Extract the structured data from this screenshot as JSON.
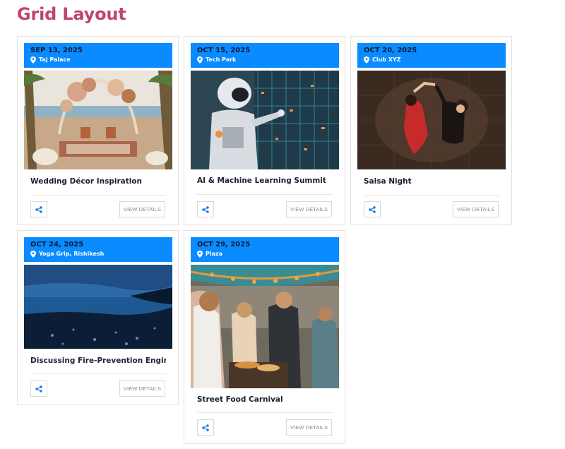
{
  "page": {
    "title": "Grid Layout"
  },
  "colors": {
    "title": "#c0456d",
    "header": "#0a8bff",
    "date_text": "#0c1a33"
  },
  "events": [
    {
      "date": "SEP 13, 2025",
      "venue": "Taj Palace",
      "title": "Wedding Décor Inspiration",
      "image_icon": "wedding-arch-image",
      "share_icon": "share-icon",
      "details_label": "VIEW DETAILS"
    },
    {
      "date": "OCT 15, 2025",
      "venue": "Tech Park",
      "title": "AI & Machine Learning Summit",
      "image_icon": "robot-image",
      "share_icon": "share-icon",
      "details_label": "VIEW DETAILS"
    },
    {
      "date": "OCT 20, 2025",
      "venue": "Club XYZ",
      "title": "Salsa Night",
      "image_icon": "dancing-couple-image",
      "share_icon": "share-icon",
      "details_label": "VIEW DETAILS"
    },
    {
      "date": "OCT 24, 2025",
      "venue": "Yoga Grip, Rishikesh",
      "title": "Discussing Fire-Prevention Engineer",
      "image_icon": "night-beach-image",
      "share_icon": "share-icon",
      "details_label": "VIEW DETAILS"
    },
    {
      "date": "OCT 29, 2025",
      "venue": "Plaza",
      "title": "Street Food Carnival",
      "image_icon": "food-market-image",
      "share_icon": "share-icon",
      "details_label": "VIEW DETAILS"
    }
  ]
}
